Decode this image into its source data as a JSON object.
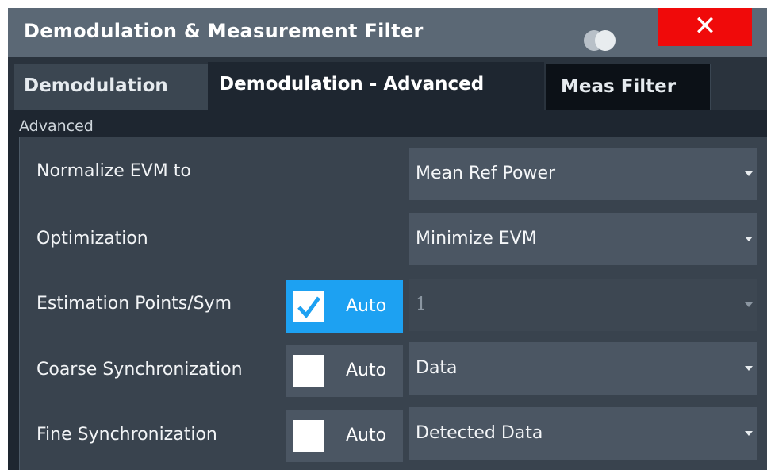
{
  "window": {
    "title": "Demodulation & Measurement Filter",
    "close_label": "✕"
  },
  "tabs": [
    {
      "label": "Demodulation",
      "active": false
    },
    {
      "label": "Demodulation - Advanced",
      "active": true
    },
    {
      "label": "Meas Filter",
      "active": false
    }
  ],
  "group": {
    "label": "Advanced"
  },
  "rows": [
    {
      "label": "Normalize EVM to",
      "value": "Mean Ref Power"
    },
    {
      "label": "Optimization",
      "value": "Minimize EVM"
    },
    {
      "label": "Estimation Points/Sym",
      "auto_label": "Auto",
      "auto_checked": true,
      "value": "1",
      "value_disabled": true
    },
    {
      "label": "Coarse Synchronization",
      "auto_label": "Auto",
      "auto_checked": false,
      "value": "Data"
    },
    {
      "label": "Fine Synchronization",
      "auto_label": "Auto",
      "auto_checked": false,
      "value": "Detected Data"
    }
  ],
  "colors": {
    "accent": "#1da1f2",
    "close": "#f00a0a",
    "titlebar": "#5b6875"
  }
}
